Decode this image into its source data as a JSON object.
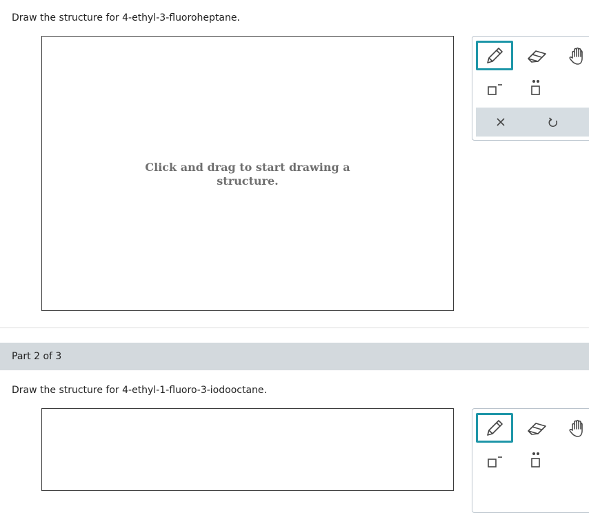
{
  "part1": {
    "prompt": "Draw the structure for 4-ethyl-3-fluoroheptane.",
    "hint_line1": "Click and drag to start drawing a",
    "hint_line2": "structure."
  },
  "part2": {
    "header": "Part 2 of 3",
    "prompt": "Draw the structure for 4-ethyl-1-fluoro-3-iodooctane."
  },
  "toolbar": {
    "icons": [
      "pencil-icon",
      "eraser-icon",
      "hand-icon",
      "charge-icon",
      "lone-pair-icon",
      "clear-icon",
      "undo-icon"
    ],
    "accent_color": "#1e96a8",
    "bar_color": "#d6dde2"
  }
}
